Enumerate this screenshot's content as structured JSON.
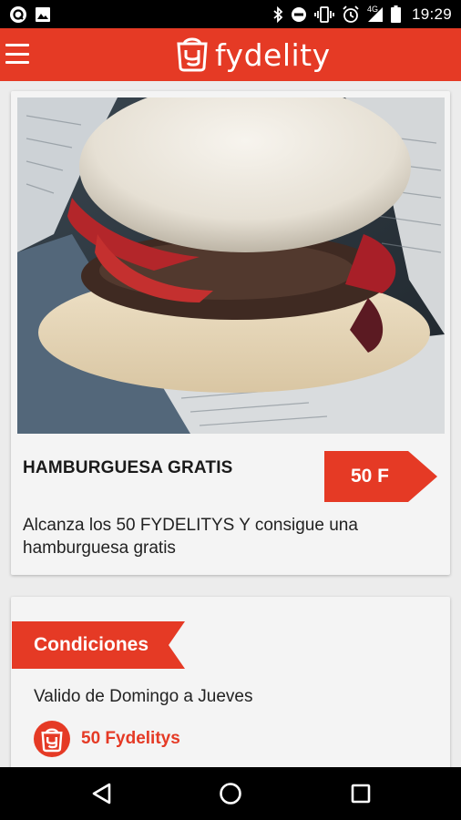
{
  "status_bar": {
    "time": "19:29",
    "network": "4G",
    "icons_left": [
      "app-notification-icon",
      "image-icon"
    ],
    "icons_right": [
      "bluetooth-icon",
      "do-not-disturb-icon",
      "vibrate-icon",
      "alarm-icon",
      "signal-icon",
      "battery-icon"
    ]
  },
  "app_bar": {
    "brand": "fydelity",
    "menu_icon": "hamburger-menu-icon",
    "color": "#e53a25"
  },
  "reward": {
    "title": "HAMBURGUESA GRATIS",
    "points_badge": "50 F",
    "description": "Alcanza los 50 FYDELITYS Y consigue una hamburguesa gratis"
  },
  "conditions": {
    "header": "Condiciones",
    "text": "Valido de Domingo a Jueves",
    "points_label": "50 Fydelitys"
  },
  "nav_bar": {
    "back_icon": "back-triangle-icon",
    "home_icon": "home-circle-icon",
    "recents_icon": "recents-square-icon"
  }
}
